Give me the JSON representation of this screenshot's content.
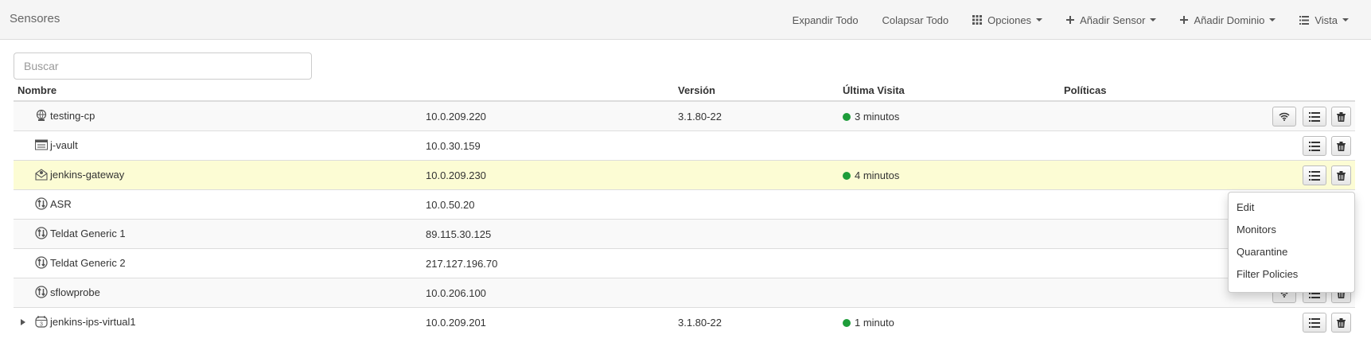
{
  "header": {
    "title": "Sensores",
    "expand_all": "Expandir Todo",
    "collapse_all": "Colapsar Todo",
    "options": "Opciones",
    "add_sensor": "Añadir Sensor",
    "add_domain": "Añadir Dominio",
    "view": "Vista"
  },
  "search": {
    "placeholder": "Buscar",
    "value": ""
  },
  "table": {
    "columns": [
      "Nombre",
      "",
      "Versión",
      "Última Visita",
      "Políticas"
    ],
    "rows": [
      {
        "name": "testing-cp",
        "ip": "10.0.209.220",
        "version": "3.1.80-22",
        "last_seen": "3 minutos",
        "icon": "globe-sensor-icon"
      },
      {
        "name": "j-vault",
        "ip": "10.0.30.159",
        "version": "",
        "last_seen": "",
        "icon": "vault-icon"
      },
      {
        "name": "jenkins-gateway",
        "ip": "10.0.209.230",
        "version": "",
        "last_seen": "4 minutos",
        "icon": "gateway-icon"
      },
      {
        "name": "ASR",
        "ip": "10.0.50.20",
        "version": "",
        "last_seen": "",
        "icon": "router-icon"
      },
      {
        "name": "Teldat Generic 1",
        "ip": "89.115.30.125",
        "version": "",
        "last_seen": "",
        "icon": "router-icon"
      },
      {
        "name": "Teldat Generic 2",
        "ip": "217.127.196.70",
        "version": "",
        "last_seen": "",
        "icon": "router-icon"
      },
      {
        "name": "sflowprobe",
        "ip": "10.0.206.100",
        "version": "",
        "last_seen": "",
        "icon": "router-icon"
      },
      {
        "name": "jenkins-ips-virtual1",
        "ip": "10.0.209.201",
        "version": "3.1.80-22",
        "last_seen": "1 minuto",
        "icon": "ips-icon"
      }
    ]
  },
  "context_menu": {
    "items": [
      "Edit",
      "Monitors",
      "Quarantine",
      "Filter Policies"
    ]
  },
  "colors": {
    "highlight_row": "#fcfcd4",
    "status_online": "#1e9d3a"
  }
}
